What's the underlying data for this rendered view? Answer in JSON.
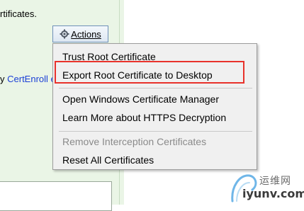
{
  "left_panel": {
    "cut_text": "rtificates.",
    "link_prefix": "y ",
    "link_text": "CertEnroll e"
  },
  "actions_button": {
    "label": "Actions",
    "icon": "gear-icon"
  },
  "menu": {
    "items": [
      {
        "label": "Trust Root Certificate",
        "enabled": true
      },
      {
        "label": "Export Root Certificate to Desktop",
        "enabled": true
      },
      {
        "label": "Open Windows Certificate Manager",
        "enabled": true
      },
      {
        "label": "Learn More about HTTPS Decryption",
        "enabled": true
      },
      {
        "label": "Remove Interception Certificates",
        "enabled": false
      },
      {
        "label": "Reset All Certificates",
        "enabled": true
      }
    ],
    "highlighted_item": "Export Root Certificate to Desktop",
    "highlight_color": "#e8322b"
  },
  "watermark": {
    "top_text": "运维网",
    "bottom_text": "iyunv.com",
    "logo_icon": "swirl-logo-icon"
  }
}
